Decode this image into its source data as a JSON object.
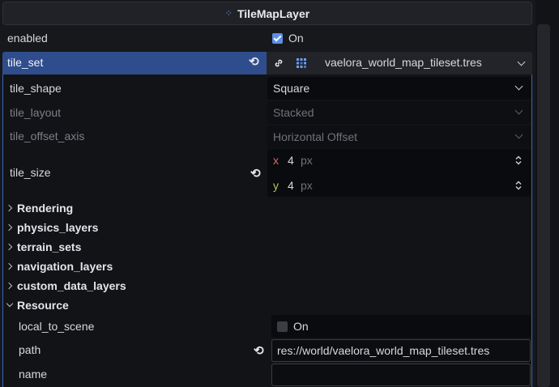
{
  "inspector": {
    "title": "TileMapLayer",
    "title_icon": "tilemaplayer-icon",
    "accent_color": "#5d8ee8",
    "selection_color": "#2f4d8c"
  },
  "rows": {
    "enabled": {
      "label": "enabled",
      "value_label": "On",
      "checked": true
    },
    "tile_set": {
      "label": "tile_set",
      "value": "vaelora_world_map_tileset.tres"
    },
    "tile_shape": {
      "label": "tile_shape",
      "value": "Square"
    },
    "tile_layout": {
      "label": "tile_layout",
      "value": "Stacked"
    },
    "tile_offset_axis": {
      "label": "tile_offset_axis",
      "value": "Horizontal Offset"
    },
    "tile_size": {
      "label": "tile_size",
      "x_label": "x",
      "x_value": "4",
      "x_unit": "px",
      "y_label": "y",
      "y_value": "4",
      "y_unit": "px"
    }
  },
  "sections": {
    "rendering": "Rendering",
    "physics_layers": "physics_layers",
    "terrain_sets": "terrain_sets",
    "navigation_layers": "navigation_layers",
    "custom_data_layers": "custom_data_layers",
    "resource": "Resource"
  },
  "resource": {
    "local_to_scene": {
      "label": "local_to_scene",
      "value_label": "On",
      "checked": false
    },
    "path": {
      "label": "path",
      "value": "res://world/vaelora_world_map_tileset.tres"
    },
    "name": {
      "label": "name",
      "value": ""
    }
  }
}
